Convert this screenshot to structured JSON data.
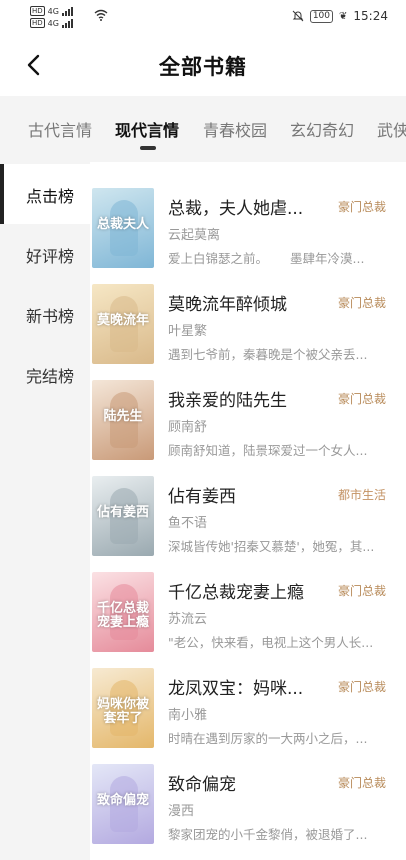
{
  "status_bar": {
    "sim1": "HD",
    "sim2": "HD",
    "net1": "4G",
    "net2": "4G",
    "battery": "100",
    "time": "15:24"
  },
  "header": {
    "title": "全部书籍",
    "back_icon": "chevron-left-icon"
  },
  "category_tabs": [
    {
      "label": "古代言情",
      "active": false
    },
    {
      "label": "现代言情",
      "active": true
    },
    {
      "label": "青春校园",
      "active": false
    },
    {
      "label": "玄幻奇幻",
      "active": false
    },
    {
      "label": "武侠",
      "active": false
    }
  ],
  "rank_menu": [
    {
      "label": "点击榜",
      "active": true
    },
    {
      "label": "好评榜",
      "active": false
    },
    {
      "label": "新书榜",
      "active": false
    },
    {
      "label": "完结榜",
      "active": false
    }
  ],
  "books": [
    {
      "title": "总裁，夫人她虐...",
      "tag": "豪门总裁",
      "author": "云起莫离",
      "desc_a": "爱上白锦瑟之前。",
      "desc_b": "墨肆年冷漠...",
      "cover_text": "总裁夫人",
      "cover_colors": [
        "#cfe6ef",
        "#7fb6d6"
      ]
    },
    {
      "title": "莫晚流年醉倾城",
      "tag": "豪门总裁",
      "author": "叶星繁",
      "desc_a": "遇到七爷前，秦暮晚是个被父亲丢...",
      "desc_b": "",
      "cover_text": "莫晚流年",
      "cover_colors": [
        "#f6e7c5",
        "#d9b98a"
      ]
    },
    {
      "title": "我亲爱的陆先生",
      "tag": "豪门总裁",
      "author": "顾南舒",
      "desc_a": "顾南舒知道，陆景琛爱过一个女人...",
      "desc_b": "",
      "cover_text": "陆先生",
      "cover_colors": [
        "#f4e6d8",
        "#c99a78"
      ]
    },
    {
      "title": "佔有姜西",
      "tag": "都市生活",
      "author": "鱼不语",
      "desc_a": "深城皆传她'招秦又慕楚'，她冤，其...",
      "desc_b": "",
      "cover_text": "佔有姜西",
      "cover_colors": [
        "#e9eef0",
        "#9aa9b0"
      ]
    },
    {
      "title": "千亿总裁宠妻上瘾",
      "tag": "豪门总裁",
      "author": "苏流云",
      "desc_a": "\"老公，快来看，电视上这个男人长...",
      "desc_b": "",
      "cover_text": "千亿总裁宠妻上瘾",
      "cover_colors": [
        "#fbe1e4",
        "#e58b9a"
      ]
    },
    {
      "title": "龙凤双宝：妈咪...",
      "tag": "豪门总裁",
      "author": "南小雅",
      "desc_a": "时晴在遇到厉家的一大两小之后，...",
      "desc_b": "",
      "cover_text": "妈咪你被套牢了",
      "cover_colors": [
        "#f7ead2",
        "#e4b76a"
      ]
    },
    {
      "title": "致命偏宠",
      "tag": "豪门总裁",
      "author": "漫西",
      "desc_a": "黎家团宠的小千金黎俏，被退婚了...",
      "desc_b": "",
      "cover_text": "致命偏宠",
      "cover_colors": [
        "#e4e7f7",
        "#b3a9e0"
      ]
    }
  ]
}
